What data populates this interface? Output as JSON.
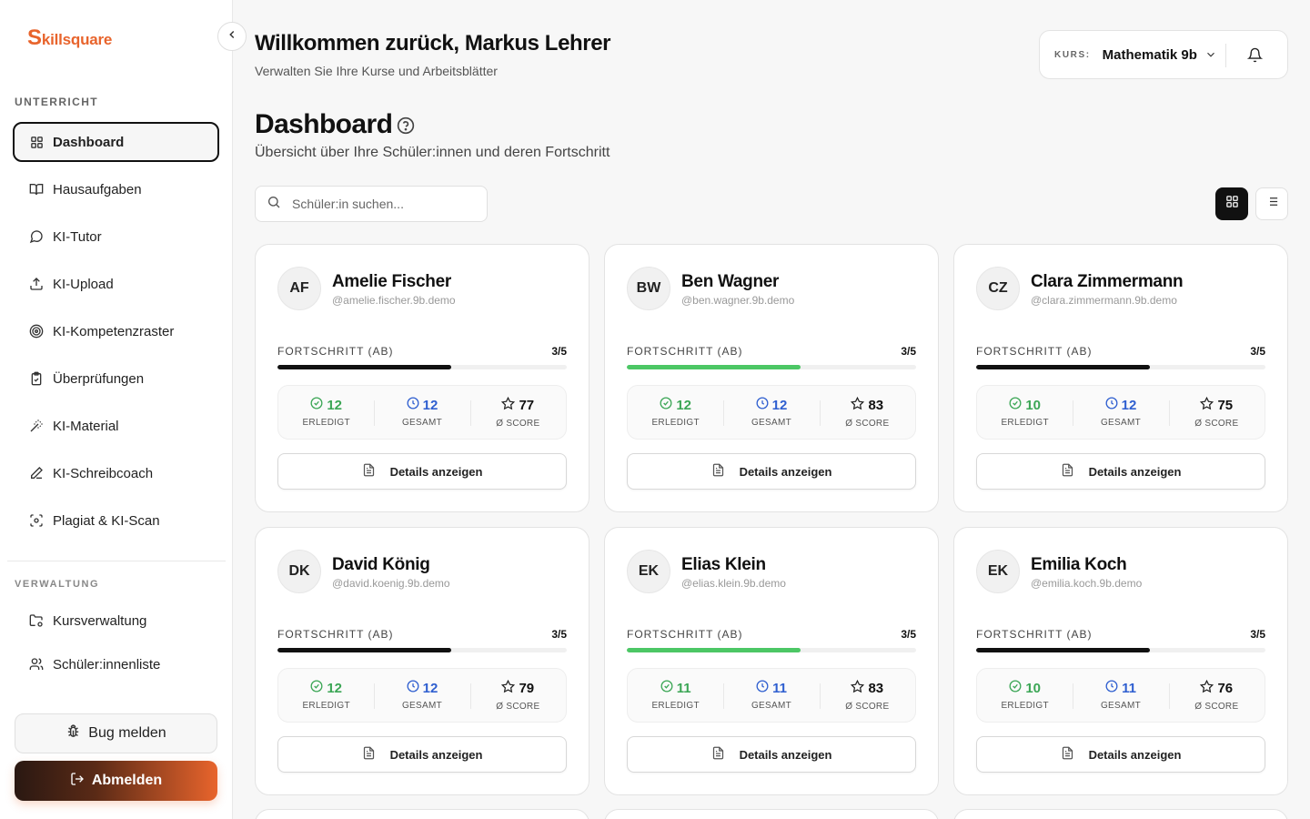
{
  "brand": {
    "logo_s": "S",
    "logo_rest": "killsquare"
  },
  "sidebar": {
    "section_unterricht": "UNTERRICHT",
    "section_verwaltung": "VERWALTUNG",
    "items": [
      {
        "label": "Dashboard",
        "icon": "layout-grid-icon"
      },
      {
        "label": "Hausaufgaben",
        "icon": "book-open-icon"
      },
      {
        "label": "KI-Tutor",
        "icon": "message-circle-icon"
      },
      {
        "label": "KI-Upload",
        "icon": "upload-icon"
      },
      {
        "label": "KI-Kompetenzraster",
        "icon": "target-icon"
      },
      {
        "label": "Überprüfungen",
        "icon": "clipboard-check-icon"
      },
      {
        "label": "KI-Material",
        "icon": "magic-wand-icon"
      },
      {
        "label": "KI-Schreibcoach",
        "icon": "pencil-icon"
      },
      {
        "label": "Plagiat & KI-Scan",
        "icon": "scan-face-icon"
      }
    ],
    "admin_items": [
      {
        "label": "Kursverwaltung",
        "icon": "folder-cog-icon"
      },
      {
        "label": "Schüler:innenliste",
        "icon": "users-icon"
      }
    ],
    "bug_label": "Bug melden",
    "logout_label": "Abmelden"
  },
  "header": {
    "welcome": "Willkommen zurück, Markus Lehrer",
    "subtitle": "Verwalten Sie Ihre Kurse und Arbeitsblätter",
    "course_label": "KURS:",
    "course_value": "Mathematik 9b"
  },
  "main": {
    "title": "Dashboard",
    "subtitle": "Übersicht über Ihre Schüler:innen und deren Fortschritt",
    "search_placeholder": "Schüler:in suchen...",
    "progress_label": "FORTSCHRITT (AB)",
    "done_label": "ERLEDIGT",
    "total_label": "GESAMT",
    "score_label": "Ø SCORE",
    "details_label": "Details anzeigen"
  },
  "colors": {
    "accent": "#e8642c",
    "green": "#3ba655",
    "blue": "#2f5fd0",
    "dark": "#111111"
  },
  "students": [
    {
      "initials": "AF",
      "name": "Amelie Fischer",
      "handle": "@amelie.fischer.9b.demo",
      "progress": "3/5",
      "progress_fraction": 0.6,
      "bar_color": "#111111",
      "done": "12",
      "total": "12",
      "score": "77"
    },
    {
      "initials": "BW",
      "name": "Ben Wagner",
      "handle": "@ben.wagner.9b.demo",
      "progress": "3/5",
      "progress_fraction": 0.6,
      "bar_color": "#4cc765",
      "done": "12",
      "total": "12",
      "score": "83"
    },
    {
      "initials": "CZ",
      "name": "Clara Zimmermann",
      "handle": "@clara.zimmermann.9b.demo",
      "progress": "3/5",
      "progress_fraction": 0.6,
      "bar_color": "#111111",
      "done": "10",
      "total": "12",
      "score": "75"
    },
    {
      "initials": "DK",
      "name": "David König",
      "handle": "@david.koenig.9b.demo",
      "progress": "3/5",
      "progress_fraction": 0.6,
      "bar_color": "#111111",
      "done": "12",
      "total": "12",
      "score": "79"
    },
    {
      "initials": "EK",
      "name": "Elias Klein",
      "handle": "@elias.klein.9b.demo",
      "progress": "3/5",
      "progress_fraction": 0.6,
      "bar_color": "#4cc765",
      "done": "11",
      "total": "11",
      "score": "83"
    },
    {
      "initials": "EK",
      "name": "Emilia Koch",
      "handle": "@emilia.koch.9b.demo",
      "progress": "3/5",
      "progress_fraction": 0.6,
      "bar_color": "#111111",
      "done": "10",
      "total": "11",
      "score": "76"
    }
  ]
}
